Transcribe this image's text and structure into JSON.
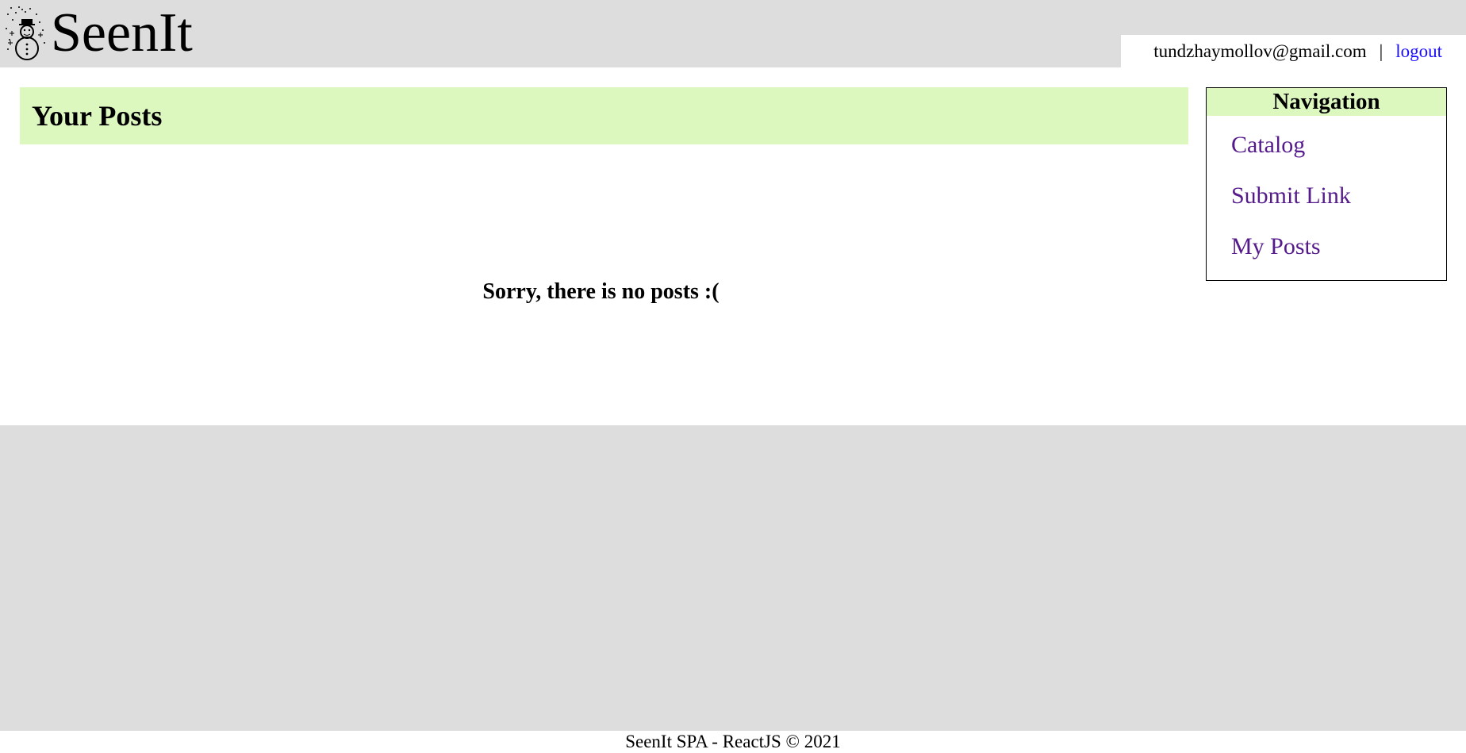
{
  "header": {
    "logo_icon": "snowman-icon",
    "title": "SeenIt",
    "user_email": "tundzhaymollov@gmail.com",
    "separator": "|",
    "logout_label": "logout"
  },
  "main": {
    "heading": "Your Posts",
    "empty_message": "Sorry, there is no posts :("
  },
  "navigation": {
    "title": "Navigation",
    "items": [
      {
        "label": "Catalog"
      },
      {
        "label": "Submit Link"
      },
      {
        "label": "My Posts"
      }
    ]
  },
  "footer": {
    "text": "SeenIt SPA - ReactJS © 2021"
  },
  "colors": {
    "header_bg": "#dddddd",
    "accent_green": "#ddf8bf",
    "logout_link": "#1a0dff",
    "nav_link": "#551a8b"
  }
}
